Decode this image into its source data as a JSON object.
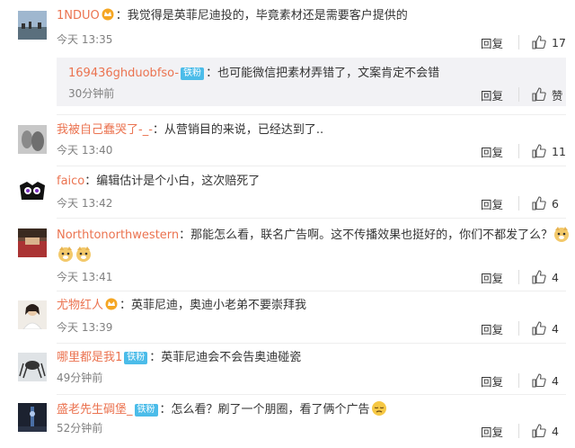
{
  "comments": [
    {
      "user": "1NDUO",
      "text": "我觉得是英菲尼迪投的，毕竟素材还是需要客户提供的",
      "time": "今天 13:35",
      "reply": "回复",
      "likes": "17"
    },
    {
      "user": "169436ghduobfso-",
      "badge": "铁粉",
      "text": "也可能微信把素材弄错了，文案肯定不会错",
      "time": "30分钟前",
      "reply": "回复",
      "likes": "赞"
    },
    {
      "user": "我被自己蠢哭了-_-",
      "text": "从营销目的来说，已经达到了..",
      "time": "今天 13:40",
      "reply": "回复",
      "likes": "11"
    },
    {
      "user": "faico",
      "text": "编辑估计是个小白，这次赔死了",
      "time": "今天 13:42",
      "reply": "回复",
      "likes": "6"
    },
    {
      "user": "Northtonorthwestern",
      "text": "那能怎么看，联名广告啊。这不传播效果也挺好的，你们不都发了么？",
      "time": "今天 13:41",
      "reply": "回复",
      "likes": "4"
    },
    {
      "user": "尤物红人",
      "text": "英菲尼迪，奥迪小老弟不要崇拜我",
      "time": "今天 13:39",
      "reply": "回复",
      "likes": "4"
    },
    {
      "user": "哪里都是我1",
      "badge": "铁粉",
      "text": "英菲尼迪会不会告奥迪碰瓷",
      "time": "49分钟前",
      "reply": "回复",
      "likes": "4"
    },
    {
      "user": "盛老先生碉堡_",
      "badge": "铁粉",
      "text": "怎么看？刷了一个朋圈，看了俩个广告",
      "time": "52分钟前",
      "reply": "回复",
      "likes": "4"
    }
  ],
  "separator": "：",
  "colors": {
    "username": "#eb7350",
    "badge": "#4bbce9",
    "time": "#808080",
    "subbox": "#f2f2f5"
  }
}
